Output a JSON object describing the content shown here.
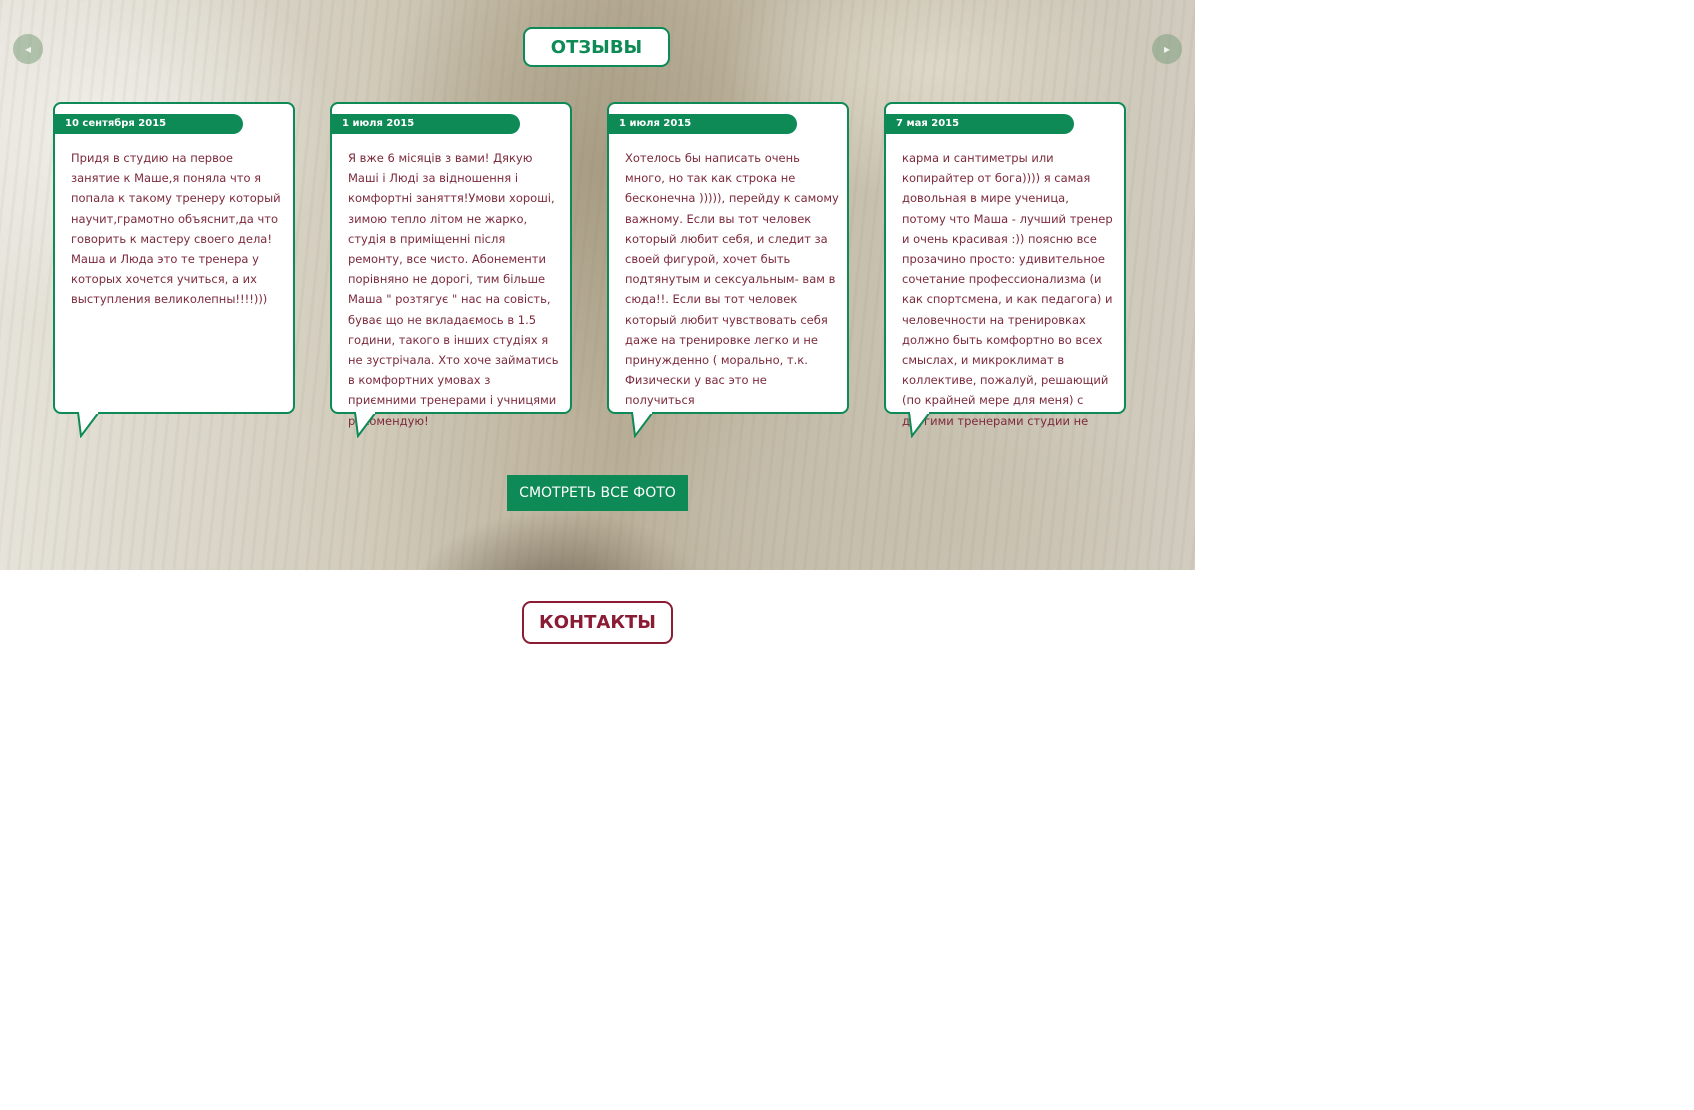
{
  "colors": {
    "accent_green": "#0d8a55",
    "review_text": "#7c2a3b",
    "contacts_accent": "#8a1c34"
  },
  "reviews_section": {
    "title": "ОТЗЫВЫ",
    "prev_arrow_icon": "chevron-left-icon",
    "next_arrow_icon": "chevron-right-icon",
    "prev_arrow_glyph": "◂",
    "next_arrow_glyph": "▸",
    "reviews": [
      {
        "date": "10 сентября 2015",
        "text": "Придя в студию на первое занятие к Маше,я поняла что я попала к такому тренеру который научит,грамотно объяснит,да что говорить к мастеру своего дела! Маша и Люда это те тренера у которых хочется учиться, а их выступления великолепны!!!!)))"
      },
      {
        "date": "1 июля 2015",
        "text": "Я вже 6 місяців з вами! Дякую Маші і Люді за відношення і комфортні заняття!Умови хороші, зимою тепло літом не жарко, студія в приміщенні після ремонту, все чисто. Абонементи порівняно не дорогі, тим більше Маша \" розтягує \" нас на совість, буває що не вкладаємось в 1.5 години, такого в інших студіях я не зустрічала. Хто хоче займатись в комфортних умовах з приємними тренерами і учницями рекомендую!"
      },
      {
        "date": "1 июля 2015",
        "text": "Хотелось бы написать очень много, но так как строка не бесконечна ))))), перейду к самому важному. Если вы тот человек который любит себя, и следит за своей фигурой, хочет быть подтянутым и сексуальным- вам в сюда!!. Если вы тот человек который любит чувствовать себя даже на тренировке легко и не принужденно ( морально, т.к. Физически у вас это не получиться"
      },
      {
        "date": "7 мая 2015",
        "text": "карма и сантиметры или копирайтер от бога)))) я самая довольная в мире ученица, потому что Маша - лучший тренер и очень красивая :)) поясню все прозачино просто: удивительное сочетание профессионализма (и как спортсмена, и как педагога) и человечности на тренировках должно быть комфортно во всех смыслах, и микроклимат в коллективе, пожалуй, решающий (по крайней мере для меня) с другими тренерами студии не"
      }
    ],
    "photos_button": "СМОТРЕТЬ ВСЕ ФОТО"
  },
  "contacts_section": {
    "title": "КОНТАКТЫ"
  }
}
